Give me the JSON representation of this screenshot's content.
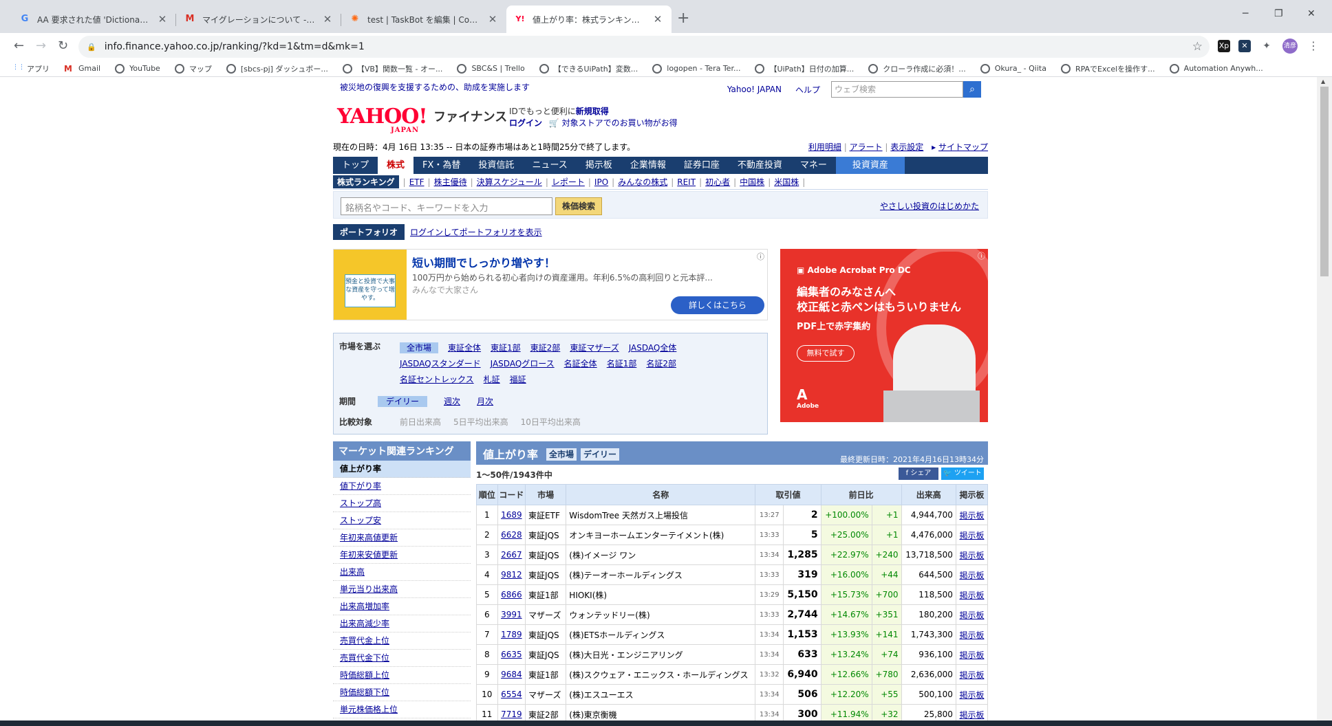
{
  "browser": {
    "tabs": [
      {
        "icon": "google-icon",
        "icon_glyph": "G",
        "icon_color": "#4285f4",
        "title": "AA 要求された値 'Dictionary' が見つかりません"
      },
      {
        "icon": "gmail-icon",
        "icon_glyph": "M",
        "icon_color": "#d93025",
        "title": "マイグレーションについて - t70.ishizaki"
      },
      {
        "icon": "controlroom-icon",
        "icon_glyph": "✺",
        "icon_color": "#ff6a13",
        "title": "test | TaskBot を編集 | Control Room"
      },
      {
        "icon": "yahoo-icon",
        "icon_glyph": "Y!",
        "icon_color": "#ff0033",
        "title": "値上がり率：株式ランキング - Yahoo!ファイナンス"
      }
    ],
    "url": "info.finance.yahoo.co.jp/ranking/?kd=1&tm=d&mk=1",
    "profile_label": "清彦",
    "bookmarks": [
      "アプリ",
      "Gmail",
      "YouTube",
      "マップ",
      "[sbcs-pj] ダッシュボー...",
      "【VB】関数一覧 - オー...",
      "SBC&S | Trello",
      "【できるUiPath】変数...",
      "logopen - Tera Ter...",
      "【UiPath】日付の加算...",
      "クローラ作成に必須！...",
      "Okura_ - Qiita",
      "RPAでExcelを操作す...",
      "Automation Anywh..."
    ]
  },
  "header": {
    "notice": "被災地の復興を支援するための、助成を実施します",
    "yahoo_japan": "Yahoo! JAPAN",
    "help": "ヘルプ",
    "search_placeholder": "ウェブ検索",
    "logo_text": "YAHOO!",
    "logo_sub": "JAPAN",
    "finance": "ファイナンス",
    "id_text": "IDでもっと便利に",
    "new_id": "新規取得",
    "login": "ログイン",
    "store_text": "対象ストアでのお買い物がお得",
    "datetime": "現在の日時：4月 16日 13:35 -- 日本の証券市場はあと1時間25分で終了します。",
    "util_links": [
      "利用明細",
      "アラート",
      "表示設定",
      "サイトマップ"
    ]
  },
  "gnav": [
    "トップ",
    "株式",
    "FX・為替",
    "投資信託",
    "ニュース",
    "掲示板",
    "企業情報",
    "証券口座",
    "不動産投資",
    "マネー",
    "投資資産"
  ],
  "subnav": {
    "current": "株式ランキング",
    "items": [
      "ETF",
      "株主優待",
      "決算スケジュール",
      "レポート",
      "IPO",
      "みんなの株式",
      "REIT",
      "初心者",
      "中国株",
      "米国株"
    ]
  },
  "stock_search": {
    "placeholder": "銘柄名やコード、キーワードを入力",
    "button": "株価検索",
    "easy_link": "やさしい投資のはじめかた"
  },
  "portfolio": {
    "label": "ポートフォリオ",
    "link": "ログインしてポートフォリオを表示"
  },
  "ad1": {
    "card": "預金と投資で大事な資産を守って増やす。",
    "title": "短い期間でしっかり増やす！",
    "desc": "100万円から始められる初心者向けの資産運用。年利6.5%の高利回りと元本評...",
    "sponsor": "みんなで大家さん",
    "button": "詳しくはこちら"
  },
  "ad2": {
    "logo": "Adobe Acrobat Pro DC",
    "headline1": "編集者のみなさんへ",
    "headline2": "校正紙と赤ペンはもういりません",
    "sub": "PDF上で赤字集約",
    "button": "無料で試す",
    "brand": "Adobe"
  },
  "market": {
    "label": "市場を選ぶ",
    "items": [
      "全市場",
      "東証全体",
      "東証1部",
      "東証2部",
      "東証マザーズ",
      "JASDAQ全体",
      "JASDAQスタンダード",
      "JASDAQグロース",
      "名証全体",
      "名証1部",
      "名証2部",
      "名証セントレックス",
      "札証",
      "福証"
    ],
    "period_label": "期間",
    "periods": [
      "デイリー",
      "週次",
      "月次"
    ],
    "compare_label": "比較対象",
    "compares": [
      "前日出来高",
      "5日平均出来高",
      "10日平均出来高"
    ]
  },
  "sidebar": {
    "title": "マーケット関連ランキング",
    "items": [
      "値上がり率",
      "値下がり率",
      "ストップ高",
      "ストップ安",
      "年初来高値更新",
      "年初来安値更新",
      "出来高",
      "単元当り出来高",
      "出来高増加率",
      "出来高減少率",
      "売買代金上位",
      "売買代金下位",
      "時価総額上位",
      "時価総額下位",
      "単元株価格上位"
    ]
  },
  "ranking": {
    "title": "値上がり率",
    "tag_market": "全市場",
    "tag_period": "デイリー",
    "updated": "最終更新日時：2021年4月16日13時34分",
    "count": "1〜50件/1943件中",
    "share": "シェア",
    "tweet": "ツイート",
    "columns": [
      "順位",
      "コード",
      "市場",
      "名称",
      "取引値",
      "前日比",
      "出来高",
      "掲示板"
    ],
    "rows": [
      [
        "1",
        "1689",
        "東証ETF",
        "WisdomTree 天然ガス上場投信",
        "13:27",
        "2",
        "+100.00%",
        "+1",
        "4,944,700",
        "掲示板"
      ],
      [
        "2",
        "6628",
        "東証JQS",
        "オンキヨーホームエンターテイメント(株)",
        "13:33",
        "5",
        "+25.00%",
        "+1",
        "4,476,000",
        "掲示板"
      ],
      [
        "3",
        "2667",
        "東証JQS",
        "(株)イメージ ワン",
        "13:34",
        "1,285",
        "+22.97%",
        "+240",
        "13,718,500",
        "掲示板"
      ],
      [
        "4",
        "9812",
        "東証JQS",
        "(株)テーオーホールディングス",
        "13:33",
        "319",
        "+16.00%",
        "+44",
        "644,500",
        "掲示板"
      ],
      [
        "5",
        "6866",
        "東証1部",
        "HIOKI(株)",
        "13:29",
        "5,150",
        "+15.73%",
        "+700",
        "118,500",
        "掲示板"
      ],
      [
        "6",
        "3991",
        "マザーズ",
        "ウォンテッドリー(株)",
        "13:33",
        "2,744",
        "+14.67%",
        "+351",
        "180,200",
        "掲示板"
      ],
      [
        "7",
        "1789",
        "東証JQS",
        "(株)ETSホールディングス",
        "13:34",
        "1,153",
        "+13.93%",
        "+141",
        "1,743,300",
        "掲示板"
      ],
      [
        "8",
        "6635",
        "東証JQS",
        "(株)大日光・エンジニアリング",
        "13:34",
        "633",
        "+13.24%",
        "+74",
        "936,100",
        "掲示板"
      ],
      [
        "9",
        "9684",
        "東証1部",
        "(株)スクウェア・エニックス・ホールディングス",
        "13:32",
        "6,940",
        "+12.66%",
        "+780",
        "2,636,000",
        "掲示板"
      ],
      [
        "10",
        "6554",
        "マザーズ",
        "(株)エスユーエス",
        "13:34",
        "506",
        "+12.20%",
        "+55",
        "500,100",
        "掲示板"
      ],
      [
        "11",
        "7719",
        "東証2部",
        "(株)東京衡機",
        "13:34",
        "300",
        "+11.94%",
        "+32",
        "25,800",
        "掲示板"
      ]
    ]
  }
}
